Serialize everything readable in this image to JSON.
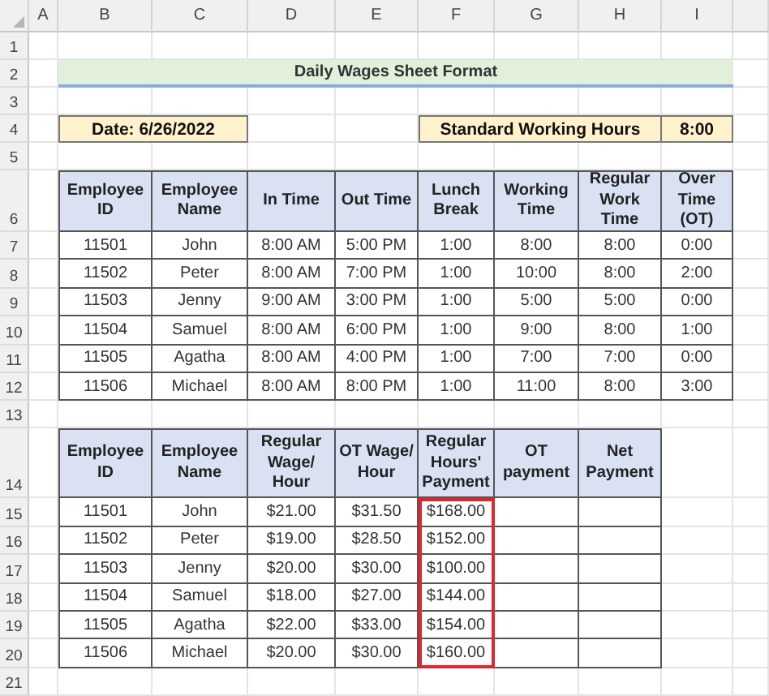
{
  "sheet": {
    "column_headers": [
      "A",
      "B",
      "C",
      "D",
      "E",
      "F",
      "G",
      "H",
      "I"
    ],
    "row_numbers": [
      "1",
      "2",
      "3",
      "4",
      "5",
      "6",
      "7",
      "8",
      "9",
      "10",
      "11",
      "12",
      "13",
      "14",
      "15",
      "16",
      "17",
      "18",
      "19",
      "20",
      "21"
    ]
  },
  "title": "Daily Wages Sheet Format",
  "date_label": "Date: 6/26/2022",
  "standard_hours": {
    "label": "Standard Working Hours",
    "value": "8:00"
  },
  "table_1": {
    "columns": [
      {
        "label": "Employee ID",
        "highlighted": false
      },
      {
        "label": "Employee Name",
        "highlighted": false
      },
      {
        "label": "In Time",
        "highlighted": false
      },
      {
        "label": "Out Time",
        "highlighted": false
      },
      {
        "label": "Lunch Break",
        "highlighted": false
      },
      {
        "label": "Working Time",
        "highlighted": false
      },
      {
        "label": "Regular Work Time",
        "highlighted": false
      },
      {
        "label": "Over Time (OT)",
        "highlighted": false
      }
    ],
    "rows": [
      [
        "11501",
        "John",
        "8:00 AM",
        "5:00 PM",
        "1:00",
        "8:00",
        "8:00",
        "0:00"
      ],
      [
        "11502",
        "Peter",
        "8:00 AM",
        "7:00 PM",
        "1:00",
        "10:00",
        "8:00",
        "2:00"
      ],
      [
        "11503",
        "Jenny",
        "9:00 AM",
        "3:00 PM",
        "1:00",
        "5:00",
        "5:00",
        "0:00"
      ],
      [
        "11504",
        "Samuel",
        "8:00 AM",
        "6:00 PM",
        "1:00",
        "9:00",
        "8:00",
        "1:00"
      ],
      [
        "11505",
        "Agatha",
        "8:00 AM",
        "4:00 PM",
        "1:00",
        "7:00",
        "7:00",
        "0:00"
      ],
      [
        "11506",
        "Michael",
        "8:00 AM",
        "8:00 PM",
        "1:00",
        "11:00",
        "8:00",
        "3:00"
      ]
    ]
  },
  "table_2": {
    "columns": [
      {
        "label": "Employee ID",
        "highlighted": false
      },
      {
        "label": "Employee Name",
        "highlighted": false
      },
      {
        "label": "Regular Wage/ Hour",
        "highlighted": false
      },
      {
        "label": "OT Wage/ Hour",
        "highlighted": false
      },
      {
        "label": "Regular Hours' Payment",
        "highlighted": true
      },
      {
        "label": "OT payment",
        "highlighted": false
      },
      {
        "label": "Net Payment",
        "highlighted": false
      }
    ],
    "rows": [
      [
        "11501",
        "John",
        "$21.00",
        "$31.50",
        "$168.00"
      ],
      [
        "11502",
        "Peter",
        "$19.00",
        "$28.50",
        "$152.00"
      ],
      [
        "11503",
        "Jenny",
        "$20.00",
        "$30.00",
        "$100.00"
      ],
      [
        "11504",
        "Samuel",
        "$18.00",
        "$27.00",
        "$144.00"
      ],
      [
        "11505",
        "Agatha",
        "$22.00",
        "$33.00",
        "$154.00"
      ],
      [
        "11506",
        "Michael",
        "$20.00",
        "$30.00",
        "$160.00"
      ]
    ]
  }
}
